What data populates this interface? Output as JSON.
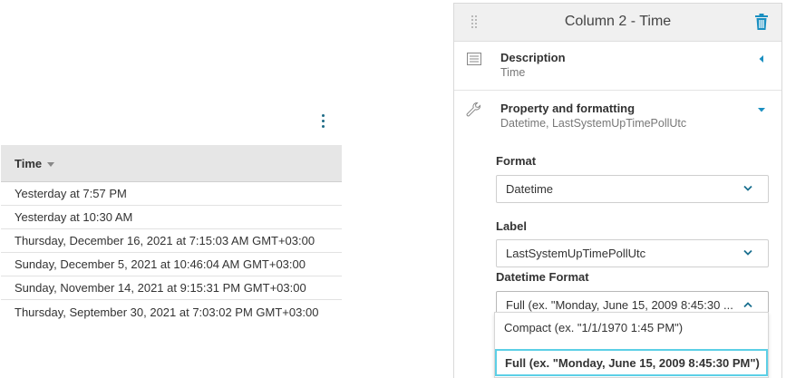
{
  "table": {
    "header": "Time",
    "rows": [
      "Yesterday at 7:57 PM",
      "Yesterday at 10:30 AM",
      "Thursday, December 16, 2021 at 7:15:03 AM GMT+03:00",
      "Sunday, December 5, 2021 at 10:46:04 AM GMT+03:00",
      "Sunday, November 14, 2021 at 9:15:31 PM GMT+03:00",
      "Thursday, September 30, 2021 at 7:03:02 PM GMT+03:00"
    ]
  },
  "panel": {
    "title": "Column 2 - Time",
    "description": {
      "title": "Description",
      "subtitle": "Time"
    },
    "property": {
      "title": "Property and formatting",
      "subtitle": "Datetime, LastSystemUpTimePollUtc"
    },
    "format": {
      "label": "Format",
      "value": "Datetime"
    },
    "label_field": {
      "label": "Label",
      "value": "LastSystemUpTimePollUtc"
    },
    "datetime_format": {
      "label": "Datetime Format",
      "value": "Full (ex. \"Monday, June 15, 2009 8:45:30 ...",
      "options": [
        "Compact (ex. \"1/1/1970 1:45 PM\")",
        "Full (ex. \"Monday, June 15, 2009 8:45:30 PM\")"
      ]
    }
  },
  "colors": {
    "accent": "#1a8fc1",
    "selected_border": "#5ccfe6",
    "header_bg": "#e6e6e6"
  },
  "icons": [
    "kebab-menu-icon",
    "sort-down-icon",
    "drag-handle-icon",
    "trash-icon",
    "list-icon",
    "wrench-icon",
    "collapse-left-icon",
    "expand-down-icon",
    "chevron-down-icon",
    "chevron-up-icon"
  ]
}
